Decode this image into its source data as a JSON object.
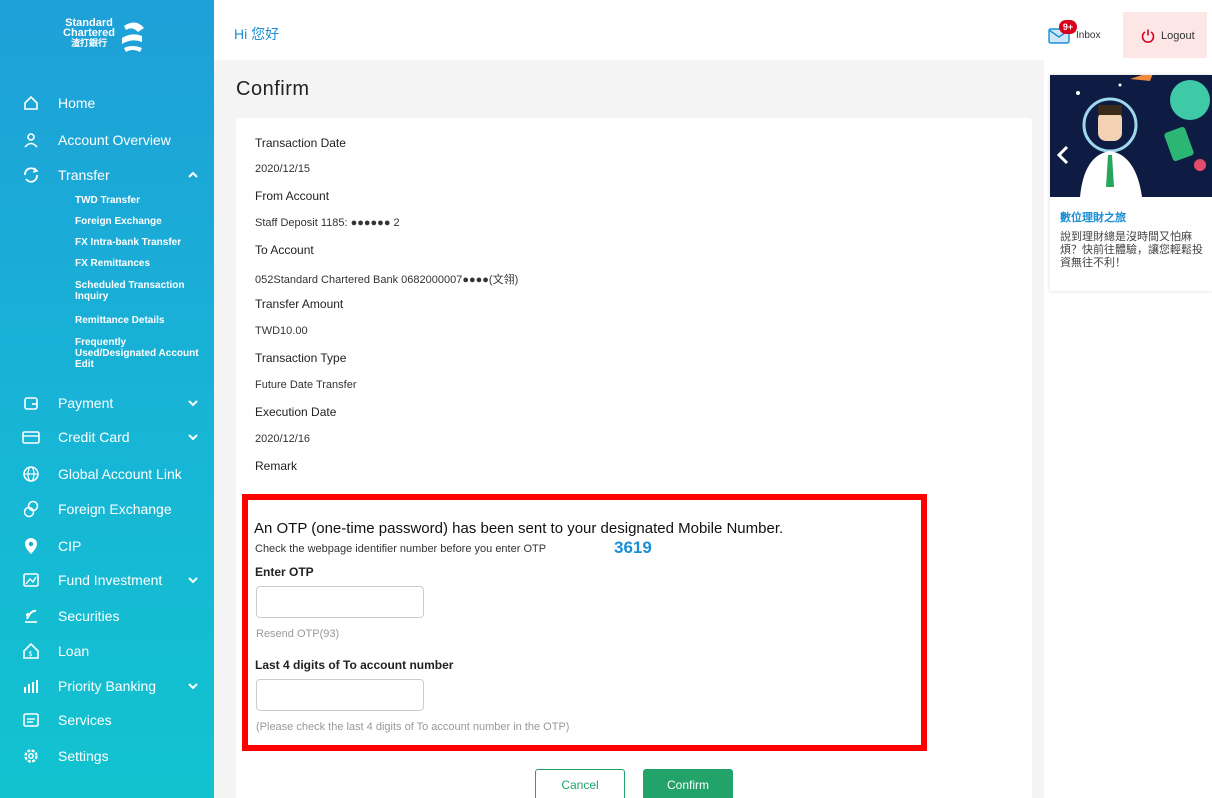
{
  "brand": {
    "logo_line1": "Standard",
    "logo_line2": "Chartered",
    "logo_line3": "渣打銀行"
  },
  "header": {
    "greeting": "Hi 您好",
    "inbox_label": "Inbox",
    "inbox_badge": "9+",
    "logout_label": "Logout"
  },
  "sidebar": {
    "items": [
      {
        "label": "Home",
        "icon": "home-icon"
      },
      {
        "label": "Account Overview",
        "icon": "user-icon"
      },
      {
        "label": "Transfer",
        "icon": "transfer-icon"
      },
      {
        "label": "Payment",
        "icon": "wallet-icon"
      },
      {
        "label": "Credit Card",
        "icon": "credit-card-icon"
      },
      {
        "label": "Global Account Link",
        "icon": "globe-icon"
      },
      {
        "label": "Foreign Exchange",
        "icon": "exchange-icon"
      },
      {
        "label": "CIP",
        "icon": "cip-icon"
      },
      {
        "label": "Fund Investment",
        "icon": "chart-icon"
      },
      {
        "label": "Securities",
        "icon": "securities-icon"
      },
      {
        "label": "Loan",
        "icon": "loan-icon"
      },
      {
        "label": "Priority Banking",
        "icon": "priority-icon"
      },
      {
        "label": "Services",
        "icon": "services-icon"
      },
      {
        "label": "Settings",
        "icon": "gear-icon"
      }
    ],
    "transfer_sub": [
      "TWD Transfer",
      "Foreign Exchange",
      "FX Intra-bank Transfer",
      "FX Remittances",
      "Scheduled Transaction Inquiry",
      "Remittance Details",
      "Frequently Used/Designated Account Edit"
    ]
  },
  "main": {
    "title": "Confirm",
    "fields": [
      {
        "label": "Transaction Date",
        "value": "2020/12/15"
      },
      {
        "label": "From Account",
        "value": "Staff Deposit 1185: ●●●●●● 2"
      },
      {
        "label": "To Account",
        "value": "052Standard Chartered Bank 0682000007●●●●(文翎)"
      },
      {
        "label": "Transfer Amount",
        "value": "TWD10.00"
      },
      {
        "label": "Transaction Type",
        "value": "Future Date Transfer"
      },
      {
        "label": "Execution Date",
        "value": "2020/12/16"
      },
      {
        "label": "Remark",
        "value": ""
      }
    ],
    "otp": {
      "title": "An OTP (one-time password) has been sent to your designated Mobile Number.",
      "identifier_text": "Check the webpage identifier number before you enter OTP",
      "identifier_code": "3619",
      "enter_label": "Enter OTP",
      "otp_value": "",
      "resend_text": "Resend OTP(93)",
      "last4_label": "Last 4 digits of To account number",
      "last4_value": "",
      "last4_hint": "(Please check the last 4 digits of To account number in the OTP)"
    },
    "cancel_label": "Cancel",
    "confirm_label": "Confirm"
  },
  "promo": {
    "title": "數位理財之旅",
    "text": "說到理財總是沒時間又怕麻煩？快前往體驗，讓您輕鬆投資無往不利！"
  },
  "colors": {
    "brand_blue": "#1a8fd6",
    "action_green": "#21a36a",
    "highlight_red": "#ff0000",
    "sidebar_start": "#1ea0d8",
    "sidebar_end": "#12c3cf"
  }
}
